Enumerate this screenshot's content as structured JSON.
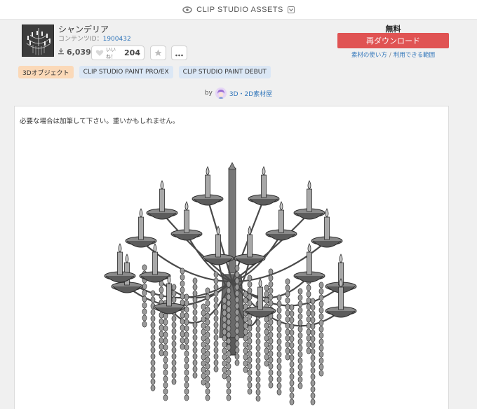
{
  "site": {
    "name": "CLIP STUDIO ASSETS",
    "logo_icon": "eye-icon",
    "menu_icon": "dropdown-box-icon"
  },
  "asset": {
    "title": "シャンデリア",
    "content_id_label": "コンテンツID：",
    "content_id": "1900432",
    "downloads": "6,039",
    "like_label": "いいね！",
    "like_count": "204"
  },
  "purchase": {
    "price": "無料",
    "button_label": "再ダウンロード",
    "link_usage": "素材の使い方",
    "link_separator": "/",
    "link_apps": "利用できる範囲"
  },
  "tags": [
    {
      "label": "3Dオブジェクト",
      "color": "#fbd9b8"
    },
    {
      "label": "CLIP STUDIO PAINT PRO/EX",
      "color": "#dbe7f5"
    },
    {
      "label": "CLIP STUDIO PAINT DEBUT",
      "color": "#dbe7f5"
    }
  ],
  "creator": {
    "by": "by",
    "name": "3D・2D素材屋"
  },
  "description": "必要な場合は加筆して下さい。重いかもしれません。",
  "colors": {
    "accent_red": "#e05353",
    "link_blue": "#3377bb"
  }
}
